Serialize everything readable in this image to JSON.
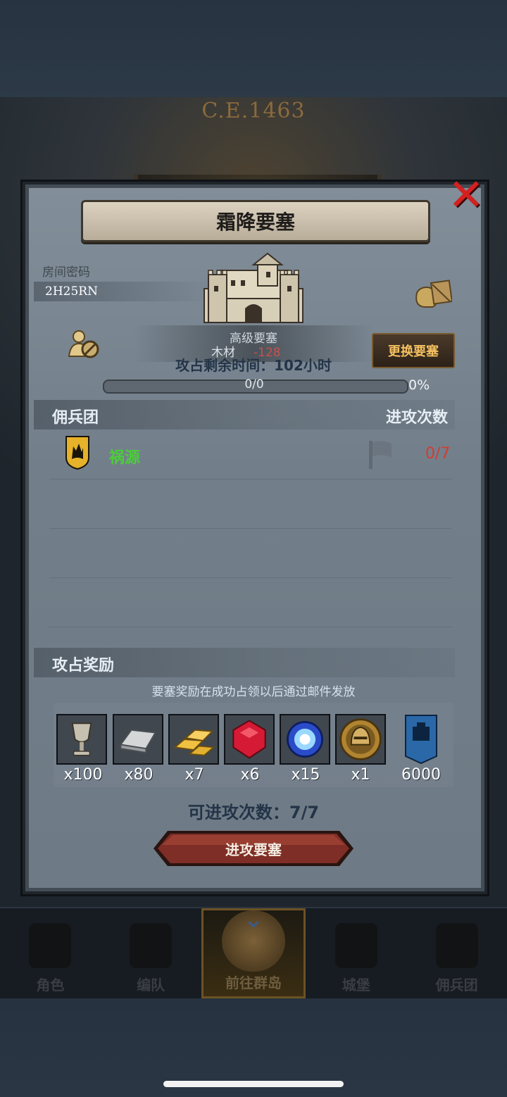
{
  "background": {
    "era_label": "C.E.1463"
  },
  "dialog": {
    "title": "霜降要塞",
    "room_code_label": "房间密码",
    "room_code": "2H25RN",
    "fortress_level": "高级要塞",
    "wood_label": "木材",
    "wood_delta": "-128",
    "attack_time_text": "攻占剩余时间：102小时",
    "swap_button": "更换要塞",
    "progress": {
      "text": "0/0",
      "percent_text": "0%",
      "fraction": 0
    },
    "mercenary_section": {
      "title": "佣兵团",
      "right_header": "进攻次数"
    },
    "mercenaries": [
      {
        "name": "祸源",
        "attacks": "0/7"
      }
    ],
    "rewards_section": {
      "title": "攻占奖励",
      "note": "要塞奖励在成功占领以后通过邮件发放",
      "items": [
        {
          "icon": "goblet-icon",
          "qty": "x100"
        },
        {
          "icon": "iron-ingot-icon",
          "qty": "x80"
        },
        {
          "icon": "gold-bars-icon",
          "qty": "x7"
        },
        {
          "icon": "ruby-icon",
          "qty": "x6"
        },
        {
          "icon": "crystal-orb-icon",
          "qty": "x15"
        },
        {
          "icon": "helmet-medal-icon",
          "qty": "x1"
        },
        {
          "icon": "fortress-banner-icon",
          "qty": "6000"
        }
      ]
    },
    "attempts_text": "可进攻次数：7/7",
    "attack_button": "进攻要塞"
  },
  "nav": [
    {
      "label": "角色",
      "icon": "knight-icon",
      "active": false
    },
    {
      "label": "编队",
      "icon": "helmet-icon",
      "active": false
    },
    {
      "label": "前往群岛",
      "icon": "compass-map-icon",
      "active": true
    },
    {
      "label": "城堡",
      "icon": "castle-icon",
      "active": false
    },
    {
      "label": "佣兵团",
      "icon": "mercenary-icon",
      "active": false
    }
  ],
  "colors": {
    "accent_gold": "#f4c060",
    "danger_red": "#d23c34",
    "merc_green": "#4ccd3a"
  }
}
